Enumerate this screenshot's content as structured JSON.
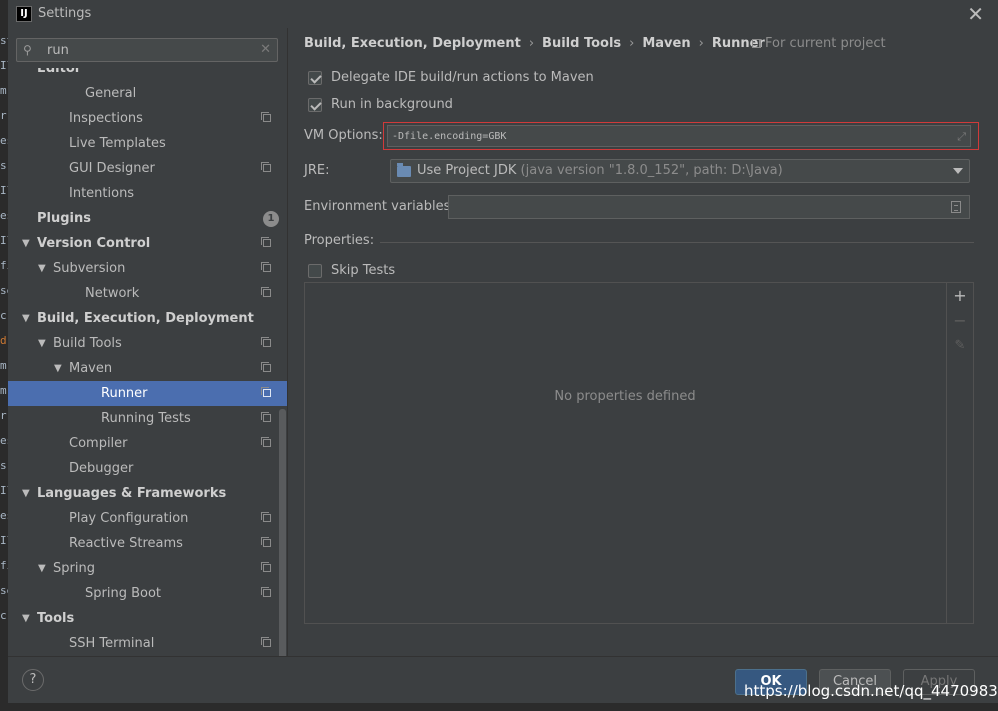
{
  "window": {
    "title": "Settings",
    "app_icon_text": "IJ"
  },
  "background_code": [
    "st",
    "Il",
    "m",
    "r",
    "es",
    "s",
    "Il",
    "es",
    "Il",
    "fi",
    "se",
    "c",
    "d",
    "m",
    "m",
    "r",
    "es",
    "s",
    "Il",
    "es",
    "Il",
    "fi",
    "se",
    "c"
  ],
  "search": {
    "value": "run"
  },
  "tree": [
    {
      "label": "Editor",
      "bold": true,
      "indent": 0,
      "expanded": null,
      "copy": false
    },
    {
      "label": "General",
      "bold": false,
      "indent": 3,
      "expanded": null,
      "copy": false,
      "partial": true
    },
    {
      "label": "Inspections",
      "bold": false,
      "indent": 2,
      "expanded": null,
      "copy": true
    },
    {
      "label": "Live Templates",
      "bold": false,
      "indent": 2,
      "expanded": null,
      "copy": false
    },
    {
      "label": "GUI Designer",
      "bold": false,
      "indent": 2,
      "expanded": null,
      "copy": true
    },
    {
      "label": "Intentions",
      "bold": false,
      "indent": 2,
      "expanded": null,
      "copy": false
    },
    {
      "label": "Plugins",
      "bold": true,
      "indent": 0,
      "expanded": null,
      "copy": false,
      "badge": "1"
    },
    {
      "label": "Version Control",
      "bold": true,
      "indent": 0,
      "expanded": true,
      "copy": true
    },
    {
      "label": "Subversion",
      "bold": false,
      "indent": 1,
      "expanded": true,
      "copy": true
    },
    {
      "label": "Network",
      "bold": false,
      "indent": 3,
      "expanded": null,
      "copy": true
    },
    {
      "label": "Build, Execution, Deployment",
      "bold": true,
      "indent": 0,
      "expanded": true,
      "copy": false
    },
    {
      "label": "Build Tools",
      "bold": false,
      "indent": 1,
      "expanded": true,
      "copy": true
    },
    {
      "label": "Maven",
      "bold": false,
      "indent": 2,
      "expanded": true,
      "copy": true
    },
    {
      "label": "Runner",
      "bold": false,
      "indent": 4,
      "expanded": null,
      "copy": true,
      "selected": true
    },
    {
      "label": "Running Tests",
      "bold": false,
      "indent": 4,
      "expanded": null,
      "copy": true
    },
    {
      "label": "Compiler",
      "bold": false,
      "indent": 2,
      "expanded": null,
      "copy": true
    },
    {
      "label": "Debugger",
      "bold": false,
      "indent": 2,
      "expanded": null,
      "copy": false
    },
    {
      "label": "Languages & Frameworks",
      "bold": true,
      "indent": 0,
      "expanded": true,
      "copy": false
    },
    {
      "label": "Play Configuration",
      "bold": false,
      "indent": 2,
      "expanded": null,
      "copy": true
    },
    {
      "label": "Reactive Streams",
      "bold": false,
      "indent": 2,
      "expanded": null,
      "copy": true
    },
    {
      "label": "Spring",
      "bold": false,
      "indent": 1,
      "expanded": true,
      "copy": true
    },
    {
      "label": "Spring Boot",
      "bold": false,
      "indent": 3,
      "expanded": null,
      "copy": true
    },
    {
      "label": "Tools",
      "bold": true,
      "indent": 0,
      "expanded": true,
      "copy": false
    },
    {
      "label": "SSH Terminal",
      "bold": false,
      "indent": 2,
      "expanded": null,
      "copy": true
    }
  ],
  "breadcrumb": [
    "Build, Execution, Deployment",
    "Build Tools",
    "Maven",
    "Runner"
  ],
  "for_project": "For current project",
  "options": {
    "delegate_label": "Delegate IDE build/run actions to Maven",
    "delegate_checked": true,
    "background_label": "Run in background",
    "background_checked": true,
    "vm_label": "VM Options:",
    "vm_value": "-Dfile.encoding=GBK",
    "jre_label": "JRE:",
    "jre_value": "Use Project JDK",
    "jre_detail": "(java version \"1.8.0_152\", path: D:\\Java)",
    "env_label": "Environment variables:",
    "env_value": "",
    "properties_label": "Properties:",
    "skip_tests_label": "Skip Tests",
    "skip_tests_checked": false,
    "no_properties": "No properties defined"
  },
  "buttons": {
    "help": "?",
    "ok": "OK",
    "cancel": "Cancel",
    "apply": "Apply"
  },
  "watermark": "https://blog.csdn.net/qq_44709837",
  "colors": {
    "selection": "#4b6eaf",
    "ok_button": "#365880",
    "highlight_border": "#d03a3a"
  }
}
